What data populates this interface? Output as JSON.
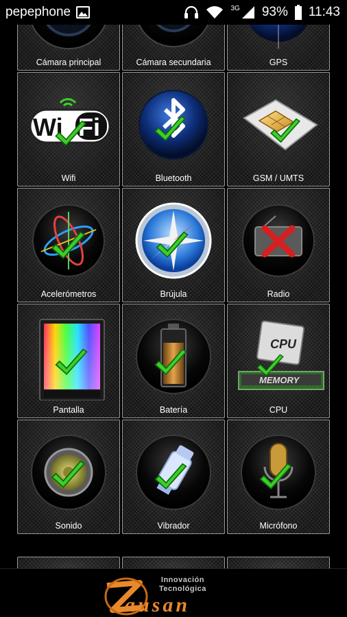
{
  "status_bar": {
    "carrier": "pepephone",
    "network": "3G",
    "battery": "93%",
    "time": "11:43"
  },
  "tiles": [
    {
      "label": "Cámara principal",
      "icon": "camera-main-icon"
    },
    {
      "label": "Cámara secundaria",
      "icon": "camera-secondary-icon"
    },
    {
      "label": "GPS",
      "icon": "gps-globe-icon"
    },
    {
      "label": "Wifi",
      "icon": "wifi-icon"
    },
    {
      "label": "Bluetooth",
      "icon": "bluetooth-icon"
    },
    {
      "label": "GSM / UMTS",
      "icon": "sim-card-icon"
    },
    {
      "label": "Acelerómetros",
      "icon": "accelerometer-icon"
    },
    {
      "label": "Brújula",
      "icon": "compass-icon"
    },
    {
      "label": "Radio",
      "icon": "radio-icon"
    },
    {
      "label": "Pantalla",
      "icon": "screen-icon"
    },
    {
      "label": "Batería",
      "icon": "battery-icon"
    },
    {
      "label": "CPU",
      "icon": "cpu-icon"
    },
    {
      "label": "Sonido",
      "icon": "speaker-icon"
    },
    {
      "label": "Vibrador",
      "icon": "vibrator-icon"
    },
    {
      "label": "Micrófono",
      "icon": "microphone-icon"
    }
  ],
  "tile_status": {
    "ok_icon": "green-check-icon",
    "fail_icon": "red-x-icon",
    "ok_color": "#3dcf2a",
    "fail_color": "#d42020"
  },
  "brand": {
    "subtitle_line1": "Innovación",
    "subtitle_line2": "Tecnológica",
    "name": "ausan",
    "accent": "#e8892a"
  }
}
